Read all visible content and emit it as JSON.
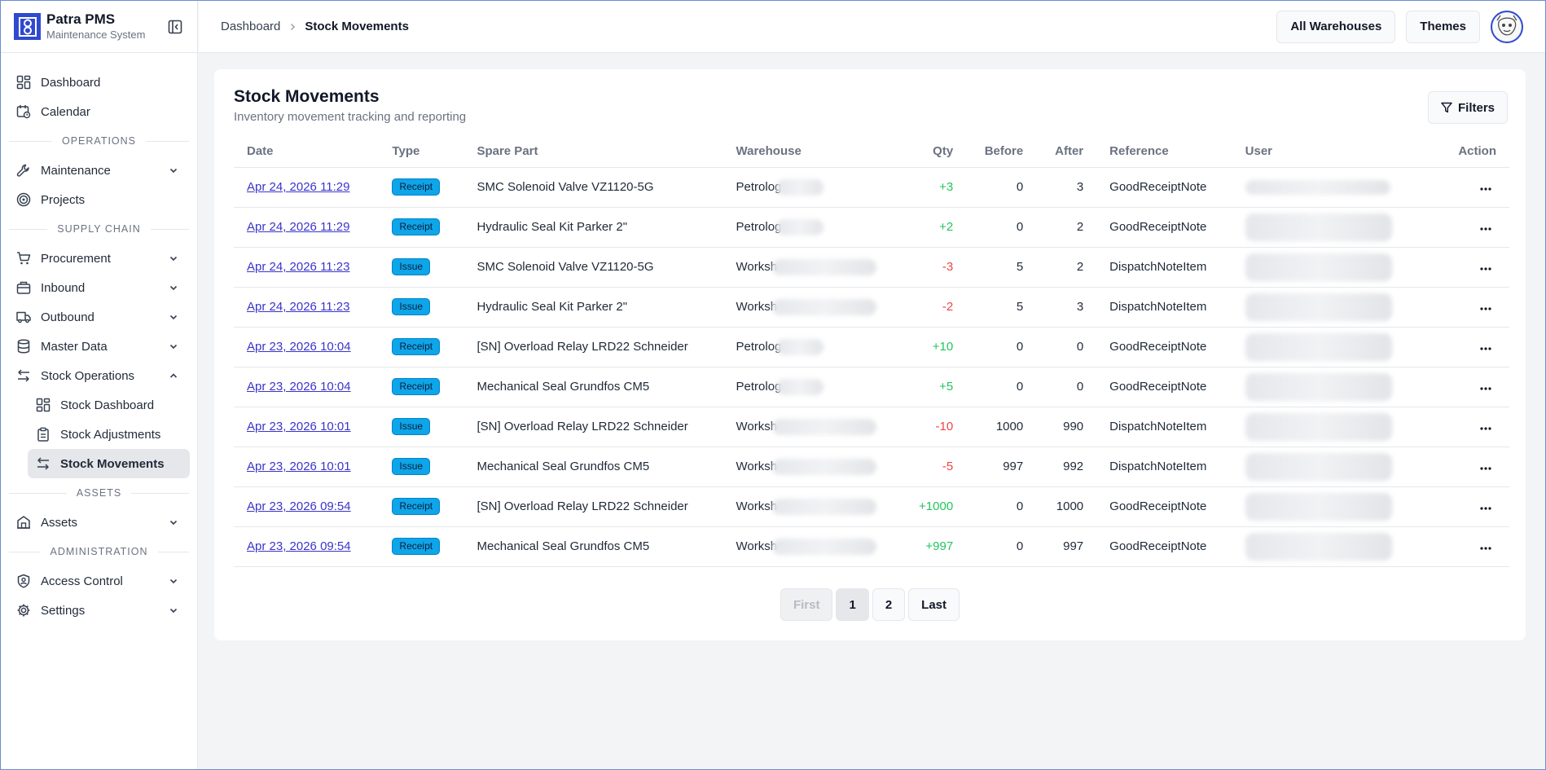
{
  "brand": {
    "title": "Patra PMS",
    "subtitle": "Maintenance System"
  },
  "sidebar": {
    "top": [
      {
        "label": "Dashboard",
        "icon": "dashboard-icon"
      },
      {
        "label": "Calendar",
        "icon": "calendar-icon"
      }
    ],
    "sections": {
      "operations": "OPERATIONS",
      "supply_chain": "SUPPLY CHAIN",
      "assets": "ASSETS",
      "administration": "ADMINISTRATION"
    },
    "operations": [
      {
        "label": "Maintenance",
        "icon": "wrench-icon"
      },
      {
        "label": "Projects",
        "icon": "target-icon"
      }
    ],
    "supply_chain": [
      {
        "label": "Procurement",
        "icon": "cart-icon"
      },
      {
        "label": "Inbound",
        "icon": "package-icon"
      },
      {
        "label": "Outbound",
        "icon": "truck-icon"
      },
      {
        "label": "Master Data",
        "icon": "database-icon"
      },
      {
        "label": "Stock Operations",
        "icon": "arrows-icon"
      }
    ],
    "stock_operations": [
      {
        "label": "Stock Dashboard",
        "icon": "dashboard-icon"
      },
      {
        "label": "Stock Adjustments",
        "icon": "clipboard-icon"
      },
      {
        "label": "Stock Movements",
        "icon": "arrows-icon"
      }
    ],
    "assets": [
      {
        "label": "Assets",
        "icon": "building-icon"
      }
    ],
    "administration": [
      {
        "label": "Access Control",
        "icon": "shield-user-icon"
      },
      {
        "label": "Settings",
        "icon": "gear-icon"
      }
    ]
  },
  "header": {
    "breadcrumb_root": "Dashboard",
    "breadcrumb_current": "Stock Movements",
    "warehouses_label": "All Warehouses",
    "themes_label": "Themes"
  },
  "page": {
    "title": "Stock Movements",
    "subtitle": "Inventory movement tracking and reporting",
    "filters_label": "Filters"
  },
  "table": {
    "columns": [
      "Date",
      "Type",
      "Spare Part",
      "Warehouse",
      "Qty",
      "Before",
      "After",
      "Reference",
      "User",
      "Action"
    ],
    "rows": [
      {
        "date": "Apr 24, 2026 11:29",
        "type": "Receipt",
        "part": "SMC Solenoid Valve VZ1120-5G",
        "warehouse": "Petrolog",
        "qty": "+3",
        "before": "0",
        "after": "3",
        "reference": "GoodReceiptNote"
      },
      {
        "date": "Apr 24, 2026 11:29",
        "type": "Receipt",
        "part": "Hydraulic Seal Kit Parker 2\"",
        "warehouse": "Petrolog",
        "qty": "+2",
        "before": "0",
        "after": "2",
        "reference": "GoodReceiptNote"
      },
      {
        "date": "Apr 24, 2026 11:23",
        "type": "Issue",
        "part": "SMC Solenoid Valve VZ1120-5G",
        "warehouse": "Worksh",
        "qty": "-3",
        "before": "5",
        "after": "2",
        "reference": "DispatchNoteItem"
      },
      {
        "date": "Apr 24, 2026 11:23",
        "type": "Issue",
        "part": "Hydraulic Seal Kit Parker 2\"",
        "warehouse": "Worksh",
        "qty": "-2",
        "before": "5",
        "after": "3",
        "reference": "DispatchNoteItem"
      },
      {
        "date": "Apr 23, 2026 10:04",
        "type": "Receipt",
        "part": "[SN] Overload Relay LRD22 Schneider",
        "warehouse": "Petrolog",
        "qty": "+10",
        "before": "0",
        "after": "0",
        "reference": "GoodReceiptNote"
      },
      {
        "date": "Apr 23, 2026 10:04",
        "type": "Receipt",
        "part": "Mechanical Seal Grundfos CM5",
        "warehouse": "Petrolog",
        "qty": "+5",
        "before": "0",
        "after": "0",
        "reference": "GoodReceiptNote"
      },
      {
        "date": "Apr 23, 2026 10:01",
        "type": "Issue",
        "part": "[SN] Overload Relay LRD22 Schneider",
        "warehouse": "Worksh",
        "qty": "-10",
        "before": "1000",
        "after": "990",
        "reference": "DispatchNoteItem"
      },
      {
        "date": "Apr 23, 2026 10:01",
        "type": "Issue",
        "part": "Mechanical Seal Grundfos CM5",
        "warehouse": "Worksh",
        "qty": "-5",
        "before": "997",
        "after": "992",
        "reference": "DispatchNoteItem"
      },
      {
        "date": "Apr 23, 2026 09:54",
        "type": "Receipt",
        "part": "[SN] Overload Relay LRD22 Schneider",
        "warehouse": "Worksh",
        "qty": "+1000",
        "before": "0",
        "after": "1000",
        "reference": "GoodReceiptNote"
      },
      {
        "date": "Apr 23, 2026 09:54",
        "type": "Receipt",
        "part": "Mechanical Seal Grundfos CM5",
        "warehouse": "Worksh",
        "qty": "+997",
        "before": "0",
        "after": "997",
        "reference": "GoodReceiptNote"
      }
    ]
  },
  "pagination": {
    "first": "First",
    "pages": [
      "1",
      "2"
    ],
    "current": "1",
    "last": "Last"
  },
  "colors": {
    "accent": "#2f49d1",
    "receipt_badge": "#0ea5e9",
    "positive": "#22c55e",
    "negative": "#ef4444",
    "link": "#3b34c9"
  }
}
